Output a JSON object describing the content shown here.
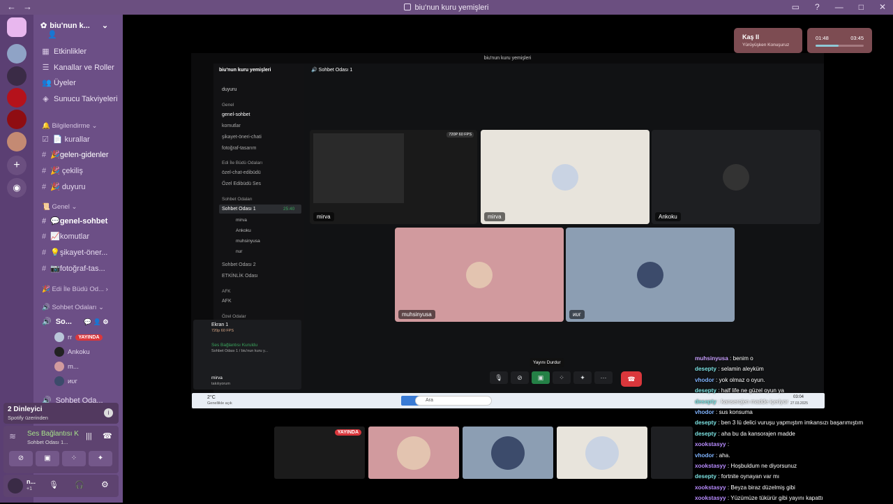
{
  "window": {
    "title": "biu'nun kuru yemişleri"
  },
  "server": {
    "name": "biu'nun k...",
    "menu": [
      "Etkinlikler",
      "Kanallar ve Roller",
      "Üyeler",
      "Sunucu Takviyeleri"
    ],
    "categories": {
      "info": "Bilgilendirme",
      "general": "Genel",
      "edi": "Edi İle Büdü Od...",
      "voice": "Sohbet Odaları"
    },
    "info_channels": [
      "kurallar",
      "gelen-gidenler",
      "çekiliş",
      "duyuru"
    ],
    "general_channels": [
      "genel-sohbet",
      "komutlar",
      "şikayet-öner...",
      "fotoğraf-tas..."
    ],
    "voice_channel": "So...",
    "voice_channel2": "Sohbet Oda...",
    "voice_users": [
      {
        "name": "rr",
        "live": "YAYINDA"
      },
      {
        "name": "Ankoku",
        "live": ""
      },
      {
        "name": "m...",
        "live": ""
      },
      {
        "name": "ᴎᴜᴦ",
        "live": ""
      }
    ]
  },
  "listeners": {
    "count": "2 Dinleyici",
    "source": "Spotify üzerinden"
  },
  "voice_panel": {
    "status": "Ses Bağlantısı K",
    "channel": "Sohbet Odası 1..."
  },
  "user_panel": {
    "name": "n...",
    "sub": "+1"
  },
  "now_playing": {
    "title": "Kaş II",
    "subtitle": "Yürüyüşken Konuşuruz",
    "time_current": "01:48",
    "time_total": "03:45",
    "progress": 0.48
  },
  "stream": {
    "inner_title": "biu'nun kuru yemişleri",
    "inner_server": "biu'nun kuru yemişleri",
    "inner_channel_header": "Sohbet Odası 1",
    "inner_channels": [
      "duyuru",
      "Genel",
      "genel-sohbet",
      "komutlar",
      "şikayet-öneri-chati",
      "fotoğraf-tasarım",
      "Edi İle Büdü Odaları",
      "özel-chat-edibüdü",
      "Özel Edibüdü Ses",
      "Sohbet Odaları",
      "Sohbet Odası 1",
      "mirva",
      "Ankoku",
      "muhsinyusa",
      "nur",
      "Sohbet Odası 2",
      "ETKİNLİK Odası",
      "AFK",
      "AFK",
      "Özel Odalar"
    ],
    "screen_panel": {
      "title": "Ekran 1",
      "fps": "720p 60 FPS",
      "status": "Ses Bağlantısı Kuruldu",
      "channel": "Sohbet Odası 1 / biu'nun kuru y...",
      "user": "mirva",
      "user_sub": "takılıyorum"
    },
    "timer": "25:40",
    "badge_live": "YAYINDA",
    "badge_fps": "720P 60 FPS",
    "tiles": [
      {
        "name": "mirva",
        "bg": "#e8e4dc"
      },
      {
        "name": "Ankoku",
        "bg": "#1e1f22"
      },
      {
        "name": "muhsinyusa",
        "bg": "#d19a9e"
      },
      {
        "name": "ᴎᴜᴦ",
        "bg": "#8c9eb3"
      },
      {
        "name": "mirva",
        "bg": "#000000"
      }
    ],
    "tooltip": "Yayını Durdur",
    "taskbar_weather": "2°C",
    "taskbar_weather_sub": "Genellikle açık",
    "taskbar_search": "Ara",
    "taskbar_time": "03:04",
    "taskbar_date": "27.03.2025"
  },
  "bottom_live": "YAYINDA",
  "chat": [
    {
      "user": "muhsinyusa",
      "text": "benim o",
      "color": "#c9a0ff"
    },
    {
      "user": "desepty",
      "text": "selamin aleyküm",
      "color": "#7be0e0"
    },
    {
      "user": "vhodor",
      "text": "yok olmaz o oyun.",
      "color": "#7fb3ff"
    },
    {
      "user": "desepty",
      "text": "half life ne güzel oyun ya",
      "color": "#7be0e0"
    },
    {
      "user": "desepty",
      "text": "kanserojen madde içeriyor",
      "color": "#7be0e0"
    },
    {
      "user": "vhodor",
      "text": "sus konsuma",
      "color": "#7fb3ff"
    },
    {
      "user": "desepty",
      "text": "ben 3 lü delici vuruşu yapmıştım imkansızı başarımıştım",
      "color": "#7be0e0"
    },
    {
      "user": "desepty",
      "text": "aha bu da kansorajen madde",
      "color": "#7be0e0"
    },
    {
      "user": "xookstasyy",
      "text": "",
      "color": "#b88cff"
    },
    {
      "user": "vhodor",
      "text": "aha.",
      "color": "#7fb3ff"
    },
    {
      "user": "xookstasyy",
      "text": "Hoşbuldum ne diyorsunuz",
      "color": "#b88cff"
    },
    {
      "user": "desepty",
      "text": "fortnite oynayan var mı",
      "color": "#7be0e0"
    },
    {
      "user": "xookstasyy",
      "text": "Beyza biraz düzelmiş gibi",
      "color": "#b88cff"
    },
    {
      "user": "xookstasyy",
      "text": "Yüzümüze tükürür gibi yayını kapattı",
      "color": "#b88cff"
    }
  ]
}
